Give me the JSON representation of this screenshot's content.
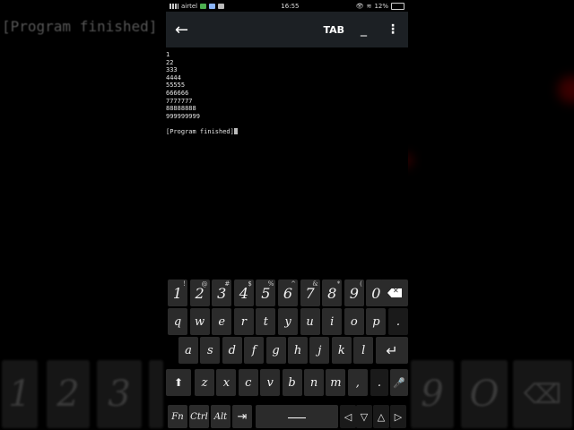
{
  "background": {
    "echo_text": "[Program finished]"
  },
  "status_bar": {
    "carrier": "airtel",
    "time": "16:55",
    "battery": "12%"
  },
  "app_bar": {
    "tab_label": "TAB",
    "minimize_label": "_"
  },
  "terminal": {
    "lines": [
      "1",
      "22",
      "333",
      "4444",
      "55555",
      "666666",
      "7777777",
      "88888888",
      "999999999"
    ],
    "finished": "[Program finished]"
  },
  "keyboard": {
    "num_row": [
      {
        "k": "1",
        "s": "!"
      },
      {
        "k": "2",
        "s": "@"
      },
      {
        "k": "3",
        "s": "#"
      },
      {
        "k": "4",
        "s": "$"
      },
      {
        "k": "5",
        "s": "%"
      },
      {
        "k": "6",
        "s": "^"
      },
      {
        "k": "7",
        "s": "&"
      },
      {
        "k": "8",
        "s": "*"
      },
      {
        "k": "9",
        "s": "("
      },
      {
        "k": "0",
        "s": ")"
      }
    ],
    "row1": [
      "q",
      "w",
      "e",
      "r",
      "t",
      "y",
      "u",
      "i",
      "o",
      "p"
    ],
    "row2": [
      "a",
      "s",
      "d",
      "f",
      "g",
      "h",
      "j",
      "k",
      "l"
    ],
    "row3": [
      "z",
      "x",
      "c",
      "v",
      "b",
      "n",
      "m",
      ","
    ],
    "fn_label": "Fn",
    "ctrl_label": "Ctrl",
    "alt_label": "Alt",
    "period_label": ".",
    "dot_label": "."
  }
}
